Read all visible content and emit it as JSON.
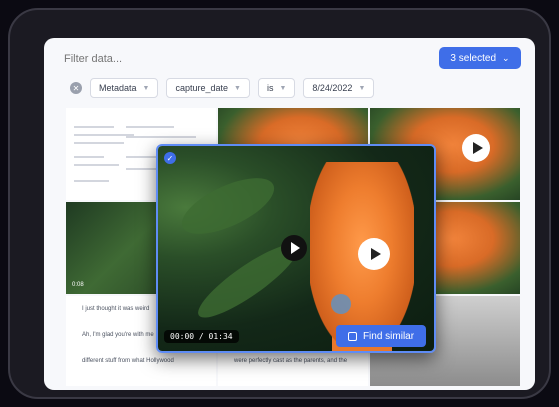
{
  "search": {
    "placeholder": "Filter data..."
  },
  "header": {
    "selected_label": "3 selected"
  },
  "filters": [
    {
      "field": "Metadata"
    },
    {
      "field": "capture_date"
    },
    {
      "field": "is"
    },
    {
      "field": "8/24/2022"
    }
  ],
  "grid": {
    "thumb_caption": "0:08",
    "doc_lines": [
      "I just thought it was weird",
      "Ah, I'm glad you're with me",
      "different stuff from what Hollywood",
      "were perfectly cast as the parents, and the"
    ]
  },
  "preview": {
    "timecode": "00:00 / 01:34",
    "find_label": "Find similar"
  },
  "colors": {
    "accent": "#3f6ee8",
    "selection_border": "#5f8cf5",
    "flower": "#ee7d2e"
  }
}
